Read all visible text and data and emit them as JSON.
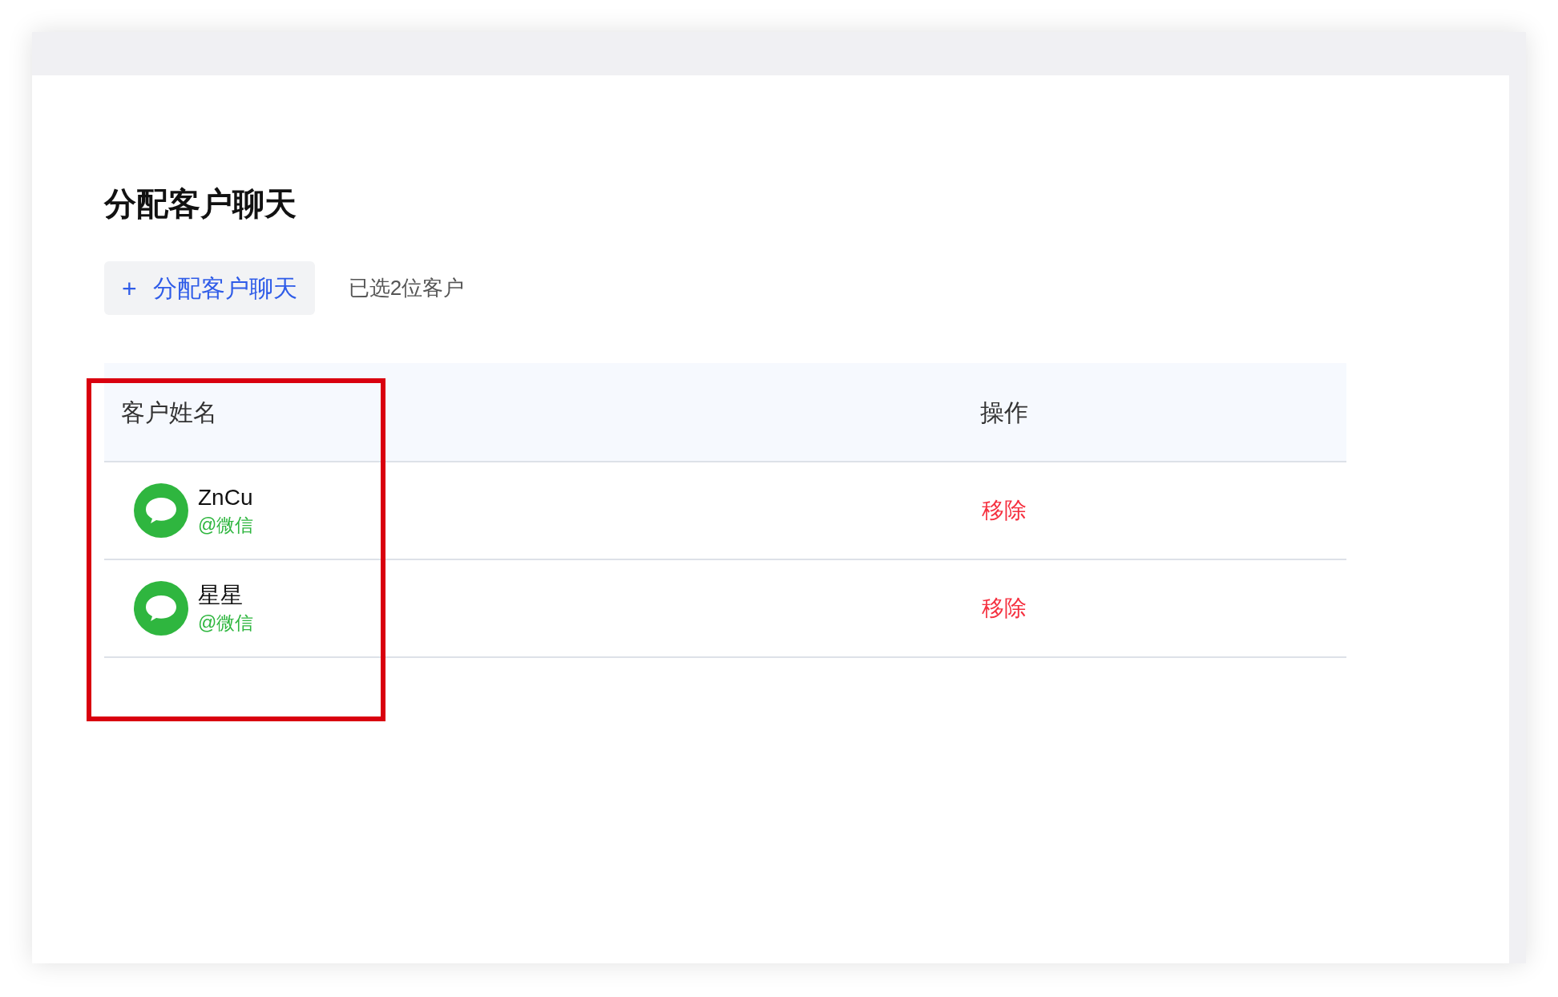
{
  "title": "分配客户聊天",
  "add_button": {
    "icon": "+",
    "label": "分配客户聊天"
  },
  "selection_count": "已选2位客户",
  "table": {
    "columns": [
      "客户姓名",
      "操作"
    ],
    "rows": [
      {
        "name": "ZnCu",
        "source": "@微信",
        "action": "移除"
      },
      {
        "name": "星星",
        "source": "@微信",
        "action": "移除"
      }
    ]
  }
}
